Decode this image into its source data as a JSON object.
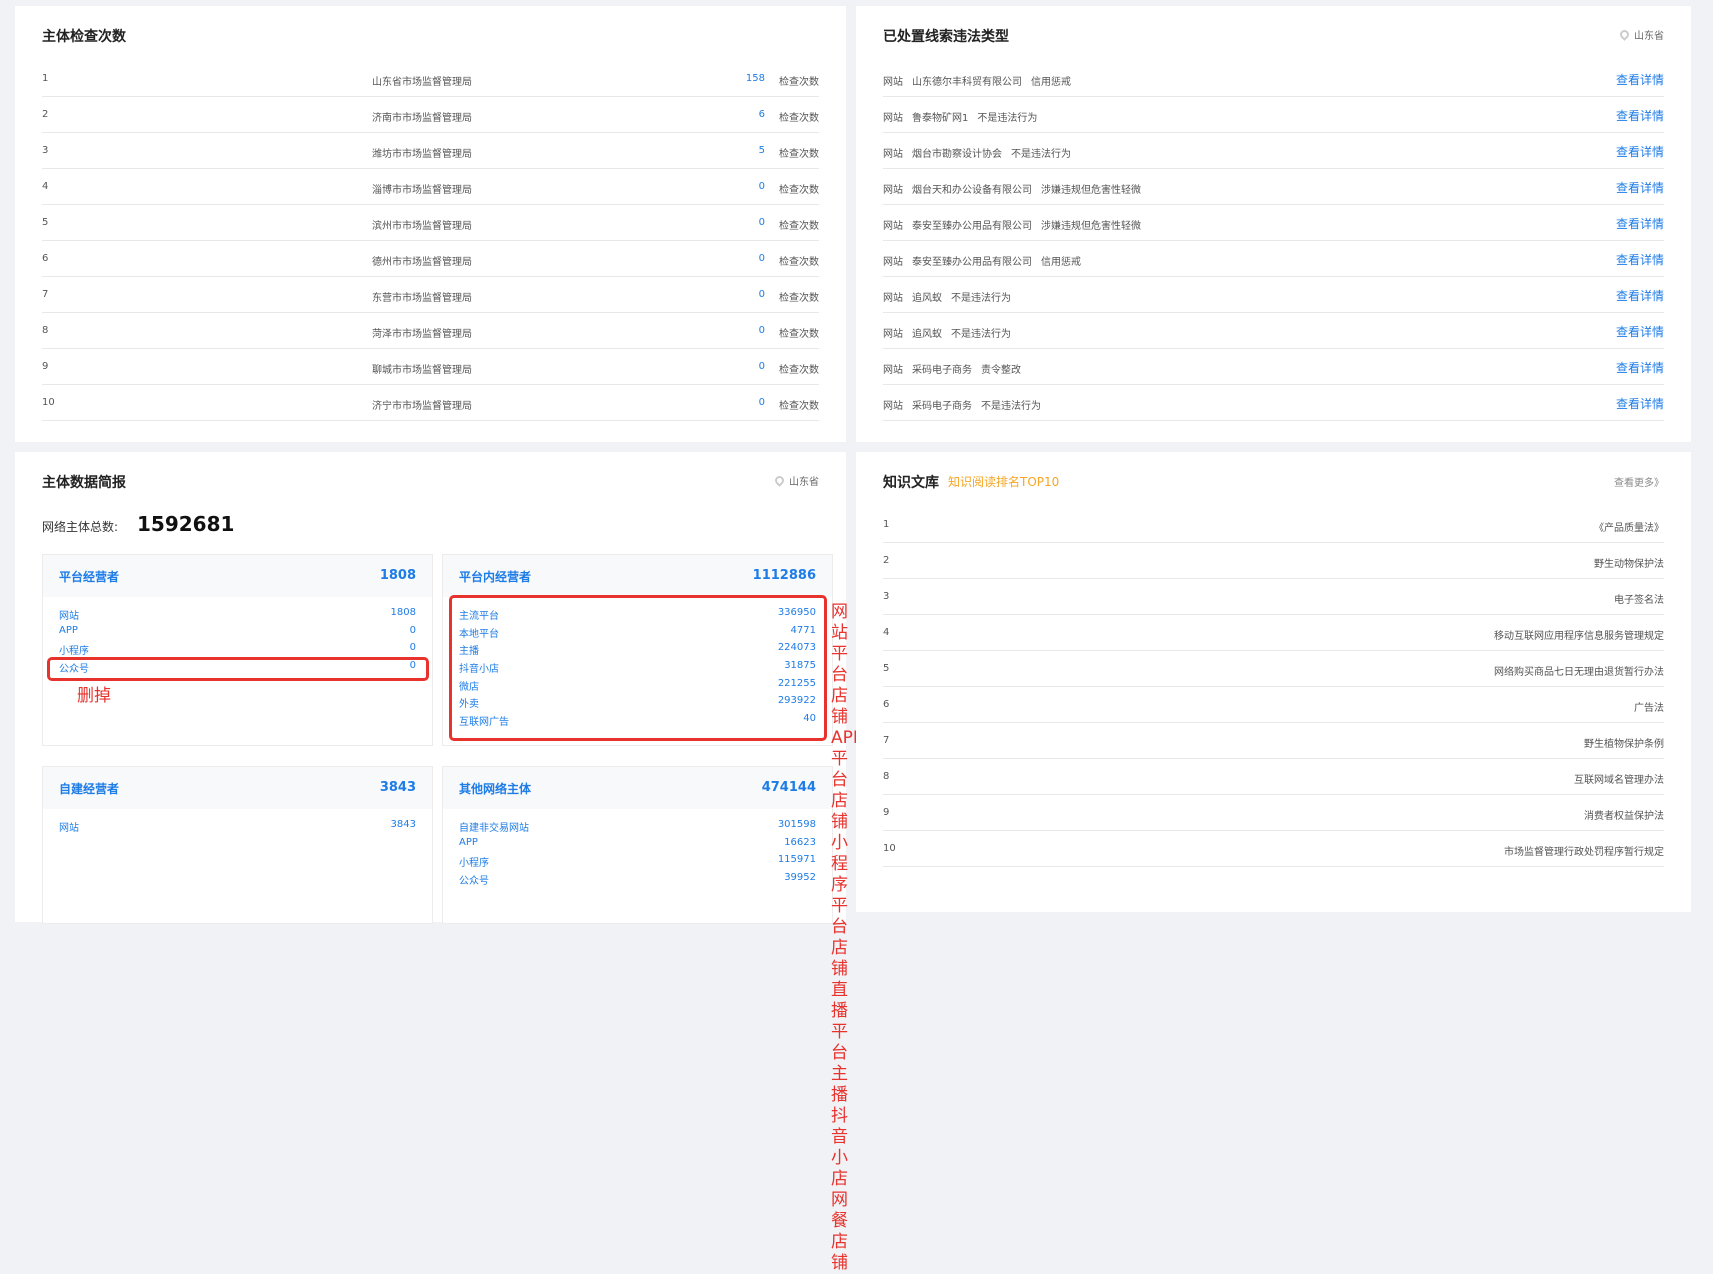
{
  "check_panel": {
    "title": "主体检查次数",
    "rows": [
      {
        "rank": "1",
        "name": "山东省市场监督管理局",
        "count": "158",
        "unit": "检查次数"
      },
      {
        "rank": "2",
        "name": "济南市市场监督管理局",
        "count": "6",
        "unit": "检查次数"
      },
      {
        "rank": "3",
        "name": "潍坊市市场监督管理局",
        "count": "5",
        "unit": "检查次数"
      },
      {
        "rank": "4",
        "name": "淄博市市场监督管理局",
        "count": "0",
        "unit": "检查次数"
      },
      {
        "rank": "5",
        "name": "滨州市市场监督管理局",
        "count": "0",
        "unit": "检查次数"
      },
      {
        "rank": "6",
        "name": "德州市市场监督管理局",
        "count": "0",
        "unit": "检查次数"
      },
      {
        "rank": "7",
        "name": "东营市市场监督管理局",
        "count": "0",
        "unit": "检查次数"
      },
      {
        "rank": "8",
        "name": "菏泽市市场监督管理局",
        "count": "0",
        "unit": "检查次数"
      },
      {
        "rank": "9",
        "name": "聊城市市场监督管理局",
        "count": "0",
        "unit": "检查次数"
      },
      {
        "rank": "10",
        "name": "济宁市市场监督管理局",
        "count": "0",
        "unit": "检查次数"
      }
    ]
  },
  "violation_panel": {
    "title": "已处置线索违法类型",
    "location": "山东省",
    "rows": [
      {
        "type": "网站",
        "company": "山东德尔丰科贸有限公司",
        "result": "信用惩戒",
        "link": "查看详情"
      },
      {
        "type": "网站",
        "company": "鲁泰物矿网1",
        "result": "不是违法行为",
        "link": "查看详情"
      },
      {
        "type": "网站",
        "company": "烟台市勘察设计协会",
        "result": "不是违法行为",
        "link": "查看详情"
      },
      {
        "type": "网站",
        "company": "烟台天和办公设备有限公司",
        "result": "涉嫌违规但危害性轻微",
        "link": "查看详情"
      },
      {
        "type": "网站",
        "company": "泰安至臻办公用品有限公司",
        "result": "涉嫌违规但危害性轻微",
        "link": "查看详情"
      },
      {
        "type": "网站",
        "company": "泰安至臻办公用品有限公司",
        "result": "信用惩戒",
        "link": "查看详情"
      },
      {
        "type": "网站",
        "company": "追风蚁",
        "result": "不是违法行为",
        "link": "查看详情"
      },
      {
        "type": "网站",
        "company": "追风蚁",
        "result": "不是违法行为",
        "link": "查看详情"
      },
      {
        "type": "网站",
        "company": "采码电子商务",
        "result": "责令整改",
        "link": "查看详情"
      },
      {
        "type": "网站",
        "company": "采码电子商务",
        "result": "不是违法行为",
        "link": "查看详情"
      }
    ]
  },
  "data_panel": {
    "title": "主体数据简报",
    "location": "山东省",
    "total_label": "网络主体总数:",
    "total_value": "1592681",
    "platform_operators": {
      "name": "平台经营者",
      "value": "1808",
      "items": [
        {
          "name": "网站",
          "value": "1808"
        },
        {
          "name": "APP",
          "value": "0"
        },
        {
          "name": "小程序",
          "value": "0"
        },
        {
          "name": "公众号",
          "value": "0"
        }
      ]
    },
    "in_platform": {
      "name": "平台内经营者",
      "value": "1112886",
      "items": [
        {
          "name": "主流平台",
          "value": "336950"
        },
        {
          "name": "本地平台",
          "value": "4771"
        },
        {
          "name": "主播",
          "value": "224073"
        },
        {
          "name": "抖音小店",
          "value": "31875"
        },
        {
          "name": "微店",
          "value": "221255"
        },
        {
          "name": "外卖",
          "value": "293922"
        },
        {
          "name": "互联网广告",
          "value": "40"
        }
      ]
    },
    "self_built": {
      "name": "自建经营者",
      "value": "3843",
      "items": [
        {
          "name": "网站",
          "value": "3843"
        }
      ]
    },
    "other": {
      "name": "其他网络主体",
      "value": "474144",
      "items": [
        {
          "name": "自建非交易网站",
          "value": "301598"
        },
        {
          "name": "APP",
          "value": "16623"
        },
        {
          "name": "小程序",
          "value": "115971"
        },
        {
          "name": "公众号",
          "value": "39952"
        }
      ]
    },
    "annotations": {
      "delete": "删掉",
      "mapping": [
        "网站平台店铺",
        "APP平台店铺",
        "小程序平台店铺",
        "直播平台主播",
        "抖音小店",
        "网餐店铺"
      ]
    }
  },
  "knowledge_panel": {
    "title": "知识文库",
    "subtitle": "知识阅读排名TOP10",
    "more": "查看更多》",
    "rows": [
      {
        "rank": "1",
        "name": "《产品质量法》"
      },
      {
        "rank": "2",
        "name": "野生动物保护法"
      },
      {
        "rank": "3",
        "name": "电子签名法"
      },
      {
        "rank": "4",
        "name": "移动互联网应用程序信息服务管理规定"
      },
      {
        "rank": "5",
        "name": "网络购买商品七日无理由退货暂行办法"
      },
      {
        "rank": "6",
        "name": "广告法"
      },
      {
        "rank": "7",
        "name": "野生植物保护条例"
      },
      {
        "rank": "8",
        "name": "互联网域名管理办法"
      },
      {
        "rank": "9",
        "name": "消费者权益保护法"
      },
      {
        "rank": "10",
        "name": "市场监督管理行政处罚程序暂行规定"
      }
    ]
  },
  "colors": {
    "accent": "#1e7ce6",
    "annotation": "#e8322d",
    "highlight": "#f5a623"
  }
}
